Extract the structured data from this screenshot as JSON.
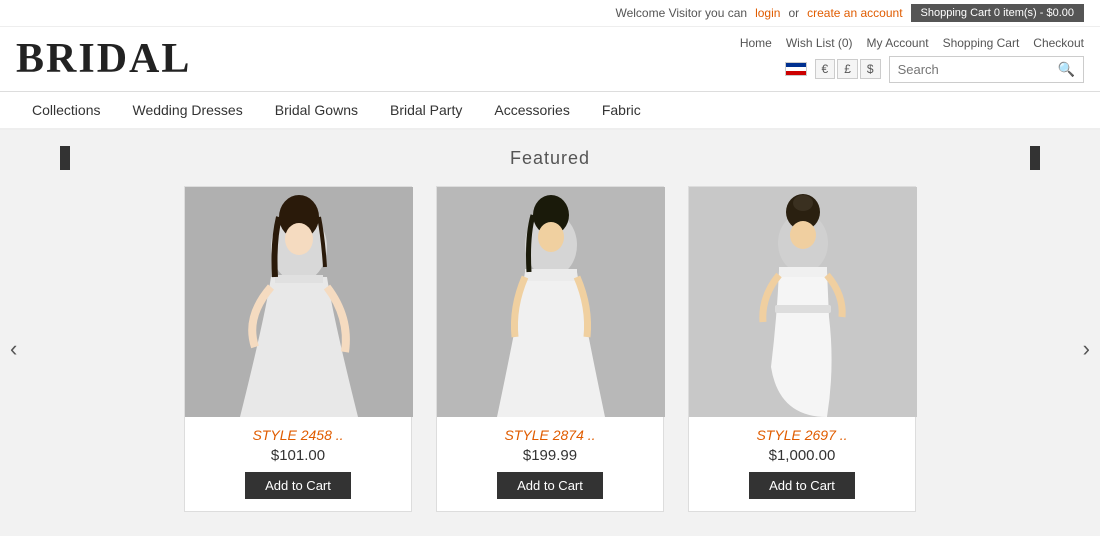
{
  "topbar": {
    "welcome_text": "Welcome Visitor you can",
    "login_text": "login",
    "or_text": "or",
    "create_account_text": "create an account",
    "cart_btn_label": "Shopping Cart  0 item(s) - $0.00",
    "nav": {
      "home": "Home",
      "wishlist": "Wish List (0)",
      "my_account": "My Account",
      "shopping_cart": "Shopping Cart",
      "checkout": "Checkout"
    }
  },
  "header": {
    "logo": "BRIDAL",
    "currency": {
      "euro": "€",
      "pound": "£",
      "dollar": "$"
    },
    "search": {
      "placeholder": "Search",
      "button_label": "🔍"
    }
  },
  "nav": {
    "items": [
      {
        "label": "Collections",
        "id": "collections"
      },
      {
        "label": "Wedding Dresses",
        "id": "wedding-dresses"
      },
      {
        "label": "Bridal Gowns",
        "id": "bridal-gowns"
      },
      {
        "label": "Bridal Party",
        "id": "bridal-party"
      },
      {
        "label": "Accessories",
        "id": "accessories"
      },
      {
        "label": "Fabric",
        "id": "fabric"
      }
    ]
  },
  "featured": {
    "title": "Featured",
    "left_block": "▮",
    "right_block": "▮",
    "products": [
      {
        "id": "product-1",
        "name": "STYLE 2458 ..",
        "price": "$101.00",
        "add_btn": "Add to Cart",
        "dress_color": "#e8e8e8",
        "bg_color": "#b8b8b8"
      },
      {
        "id": "product-2",
        "name": "STYLE 2874 ..",
        "price": "$199.99",
        "add_btn": "Add to Cart",
        "dress_color": "#f0f0f0",
        "bg_color": "#c0c0c0"
      },
      {
        "id": "product-3",
        "name": "STYLE 2697 ..",
        "price": "$1,000.00",
        "add_btn": "Add to Cart",
        "dress_color": "#f5f5f5",
        "bg_color": "#d0d0d0"
      }
    ]
  }
}
